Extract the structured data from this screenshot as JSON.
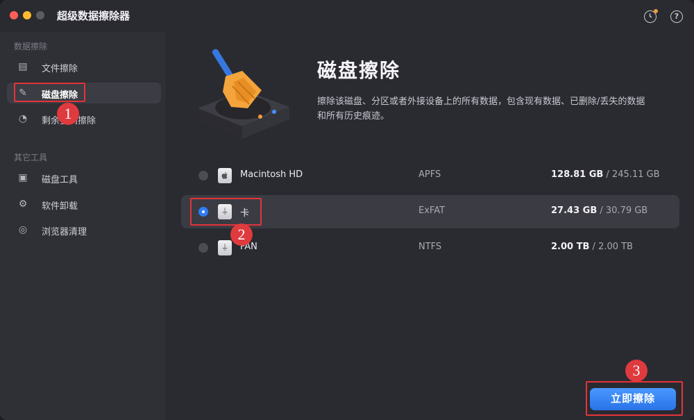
{
  "app": {
    "title": "超级数据擦除器"
  },
  "toolbar": {
    "history_icon": "clock-icon",
    "help_glyph": "?"
  },
  "sidebar": {
    "section1": "数据擦除",
    "section2": "其它工具",
    "items": [
      {
        "label": "文件擦除",
        "icon": "file-shred-icon",
        "glyph": "▤"
      },
      {
        "label": "磁盘擦除",
        "icon": "disk-erase-icon",
        "glyph": "✎",
        "active": true
      },
      {
        "label": "剩余空间擦除",
        "icon": "pie-chart-icon",
        "glyph": "◔"
      },
      {
        "label": "磁盘工具",
        "icon": "disk-tool-icon",
        "glyph": "▣"
      },
      {
        "label": "软件卸载",
        "icon": "uninstall-icon",
        "glyph": "⚙"
      },
      {
        "label": "浏览器清理",
        "icon": "browser-icon",
        "glyph": "◎"
      }
    ]
  },
  "main": {
    "heading": "磁盘擦除",
    "description": "擦除该磁盘、分区或者外接设备上的所有数据，包含现有数据、已删除/丢失的数据和所有历史痕迹。",
    "disks": [
      {
        "name": "Macintosh HD",
        "fs": "APFS",
        "used": "128.81 GB",
        "total": " / 245.11 GB",
        "selected": false,
        "glyph": ""
      },
      {
        "name": "卡",
        "fs": "ExFAT",
        "used": "27.43 GB",
        "total": " / 30.79 GB",
        "selected": true,
        "glyph": "⏚"
      },
      {
        "name": "FAN",
        "fs": "NTFS",
        "used": "2.00 TB",
        "total": " / 2.00 TB",
        "selected": false,
        "glyph": "⏚"
      }
    ],
    "erase_button": "立即擦除"
  },
  "callouts": [
    "1",
    "2",
    "3"
  ],
  "colors": {
    "accent": "#2f7cf6",
    "callout": "#e4343a"
  }
}
